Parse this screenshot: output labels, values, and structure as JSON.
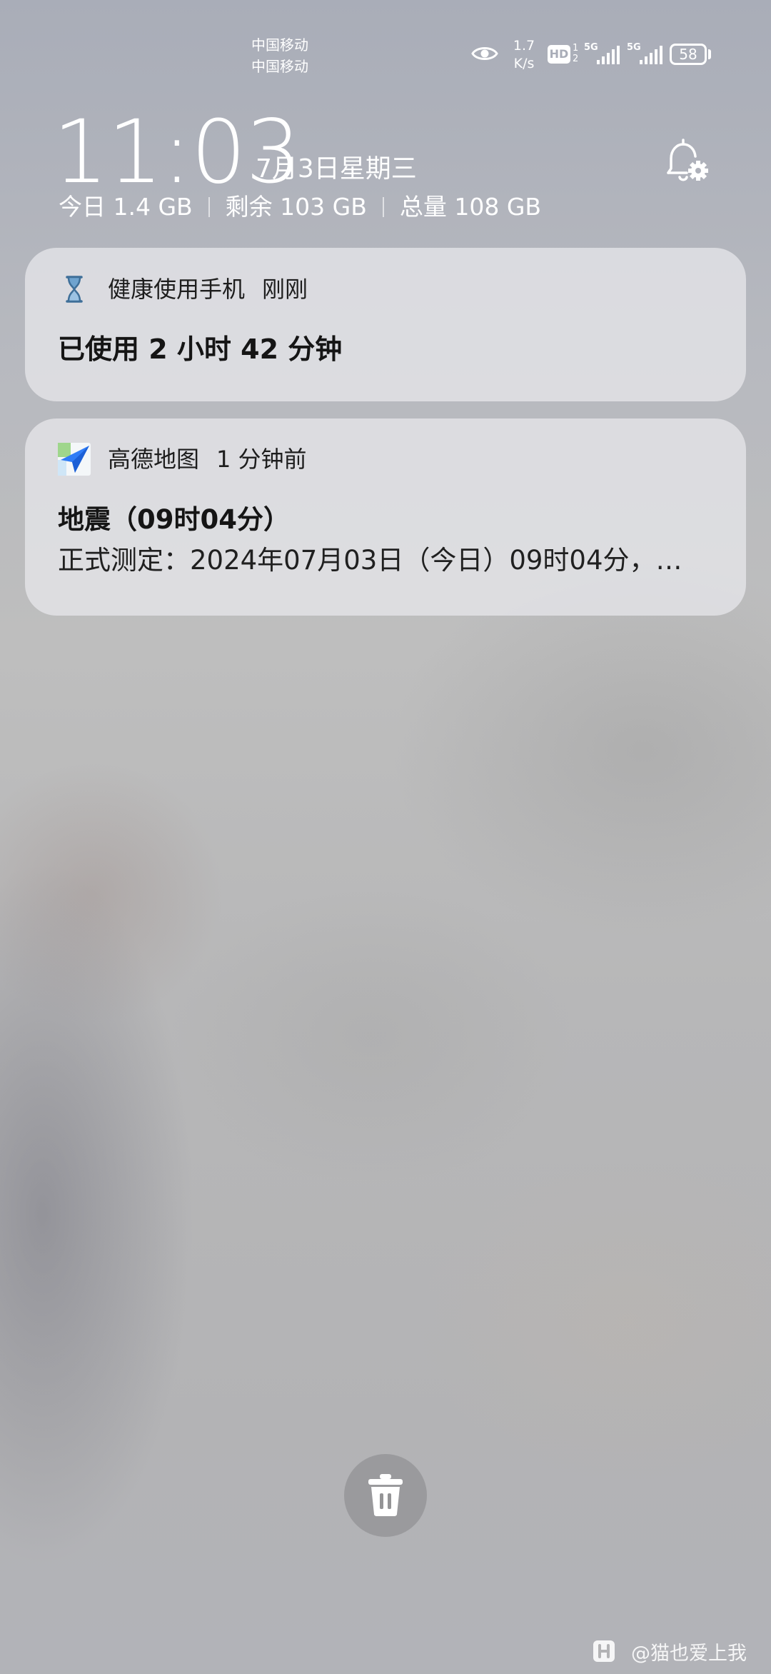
{
  "status_bar": {
    "carrier_1": "中国移动",
    "carrier_2": "中国移动",
    "net_speed_value": "1.7",
    "net_speed_unit": "K/s",
    "hd_label": "HD",
    "hd_sim_1": "1",
    "hd_sim_2": "2",
    "signal_1_tag": "5G",
    "signal_2_tag": "5G",
    "battery_level": "58",
    "icons": [
      "eye-icon",
      "hd-badge",
      "signal-bars-icon",
      "battery-icon"
    ]
  },
  "header": {
    "time": "11:03",
    "date": "7月3日星期三",
    "storage_today": "今日 1.4 GB",
    "storage_remaining": "剩余 103 GB",
    "storage_total": "总量 108 GB",
    "settings_icon": "bell-settings-icon"
  },
  "notifications": [
    {
      "app_name": "健康使用手机",
      "time": "刚刚",
      "title": "已使用 2 小时 42 分钟",
      "icon": "hourglass-icon"
    },
    {
      "app_name": "高德地图",
      "time": "1 分钟前",
      "title": "地震（09时04分）",
      "body": "正式测定：2024年07月03日（今日）09时04分，…",
      "icon": "amap-navigation-icon"
    }
  ],
  "clear_button": {
    "icon": "trash-icon"
  },
  "watermark": {
    "text": "@猫也爱上我",
    "logo_icon": "hupu-logo-icon"
  },
  "colors": {
    "status_text": "#ffffff",
    "card_background": "#e8e8ec",
    "clear_button": "#949496",
    "amap_blue": "#2f7cf6"
  }
}
